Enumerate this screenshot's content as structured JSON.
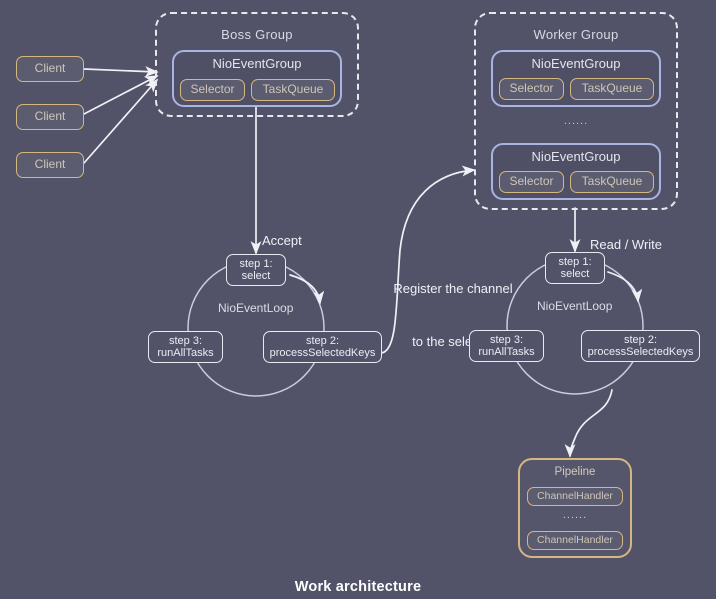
{
  "diagram": {
    "caption": "Work architecture",
    "background_color": "#525369",
    "accent_gold": "#d6b681",
    "accent_blue": "#aab4e0",
    "line_color": "#f0f0f6"
  },
  "clients": [
    {
      "label": "Client"
    },
    {
      "label": "Client"
    },
    {
      "label": "Client"
    }
  ],
  "boss_group": {
    "title": "Boss Group",
    "event_groups": [
      {
        "title": "NioEventGroup",
        "selector_label": "Selector",
        "taskqueue_label": "TaskQueue"
      }
    ]
  },
  "worker_group": {
    "title": "Worker  Group",
    "ellipsis": "......",
    "event_groups": [
      {
        "title": "NioEventGroup",
        "selector_label": "Selector",
        "taskqueue_label": "TaskQueue"
      },
      {
        "title": "NioEventGroup",
        "selector_label": "Selector",
        "taskqueue_label": "TaskQueue"
      }
    ]
  },
  "boss_loop": {
    "name": "NioEventLoop",
    "incoming_label": "Accept",
    "steps": [
      {
        "line1": "step 1:",
        "line2": "select"
      },
      {
        "line1": "step 2:",
        "line2": "processSelectedKeys"
      },
      {
        "line1": "step 3:",
        "line2": "runAllTasks"
      }
    ]
  },
  "worker_loop": {
    "name": "NioEventLoop",
    "incoming_label": "Read / Write",
    "steps": [
      {
        "line1": "step 1:",
        "line2": "select"
      },
      {
        "line1": "step 2:",
        "line2": "processSelectedKeys"
      },
      {
        "line1": "step 3:",
        "line2": "runAllTasks"
      }
    ]
  },
  "register_edge": {
    "line1": "Register the channel",
    "line2": "to the selector"
  },
  "pipeline": {
    "title": "Pipeline",
    "ellipsis": "......",
    "handlers": [
      {
        "label": "ChannelHandler"
      },
      {
        "label": "ChannelHandler"
      }
    ]
  }
}
